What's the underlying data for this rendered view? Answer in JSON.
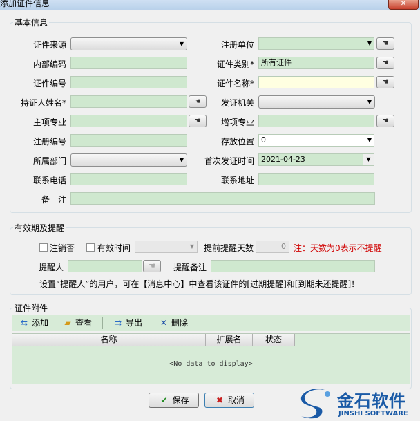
{
  "window": {
    "title": "添加证件信息",
    "close_glyph": "✕"
  },
  "basic": {
    "legend": "基本信息",
    "source_label": "证件来源",
    "source_value": "",
    "inner_code_label": "内部编码",
    "inner_code_value": "",
    "cert_no_label": "证件编号",
    "cert_no_value": "",
    "holder_label": "持证人姓名*",
    "holder_value": "",
    "major_label": "主项专业",
    "major_value": "",
    "reg_no_label": "注册编号",
    "reg_no_value": "",
    "dept_label": "所属部门",
    "dept_value": "",
    "phone_label": "联系电话",
    "phone_value": "",
    "remark_label": "备　注",
    "remark_value": "",
    "reg_unit_label": "注册单位",
    "reg_unit_value": "",
    "cert_type_label": "证件类别*",
    "cert_type_value": "所有证件",
    "cert_name_label": "证件名称*",
    "cert_name_value": "",
    "issuer_label": "发证机关",
    "issuer_value": "",
    "add_major_label": "增项专业",
    "add_major_value": "",
    "storage_label": "存放位置",
    "storage_value": "0",
    "first_issue_label": "首次发证时间",
    "first_issue_value": "2021-04-23",
    "address_label": "联系地址",
    "address_value": ""
  },
  "validity": {
    "legend": "有效期及提醒",
    "cancelled_label": "注销否",
    "valid_time_label": "有效时间",
    "valid_time_value": "",
    "advance_days_label": "提前提醒天数",
    "advance_days_value": "0",
    "note": "注：天数为0表示不提醒",
    "reminder_label": "提醒人",
    "reminder_value": "",
    "reminder_note_label": "提醒备注",
    "reminder_note_value": "",
    "info": "设置“提醒人”的用户，可在【消息中心】中查看该证件的[过期提醒]和[到期未还提醒]！"
  },
  "attachments": {
    "legend": "证件附件",
    "toolbar": {
      "add": "添加",
      "view": "查看",
      "export": "导出",
      "delete": "删除"
    },
    "columns": [
      "名称",
      "扩展名",
      "状态"
    ],
    "empty_text": "<No data to display>"
  },
  "buttons": {
    "save": "保存",
    "cancel": "取消"
  },
  "logo": {
    "name": "金石软件",
    "sub": "JINSHI SOFTWARE"
  },
  "colors": {
    "field_bg": "#cfe8cf",
    "note": "#d00000",
    "logo_blue": "#1a5aa6"
  }
}
